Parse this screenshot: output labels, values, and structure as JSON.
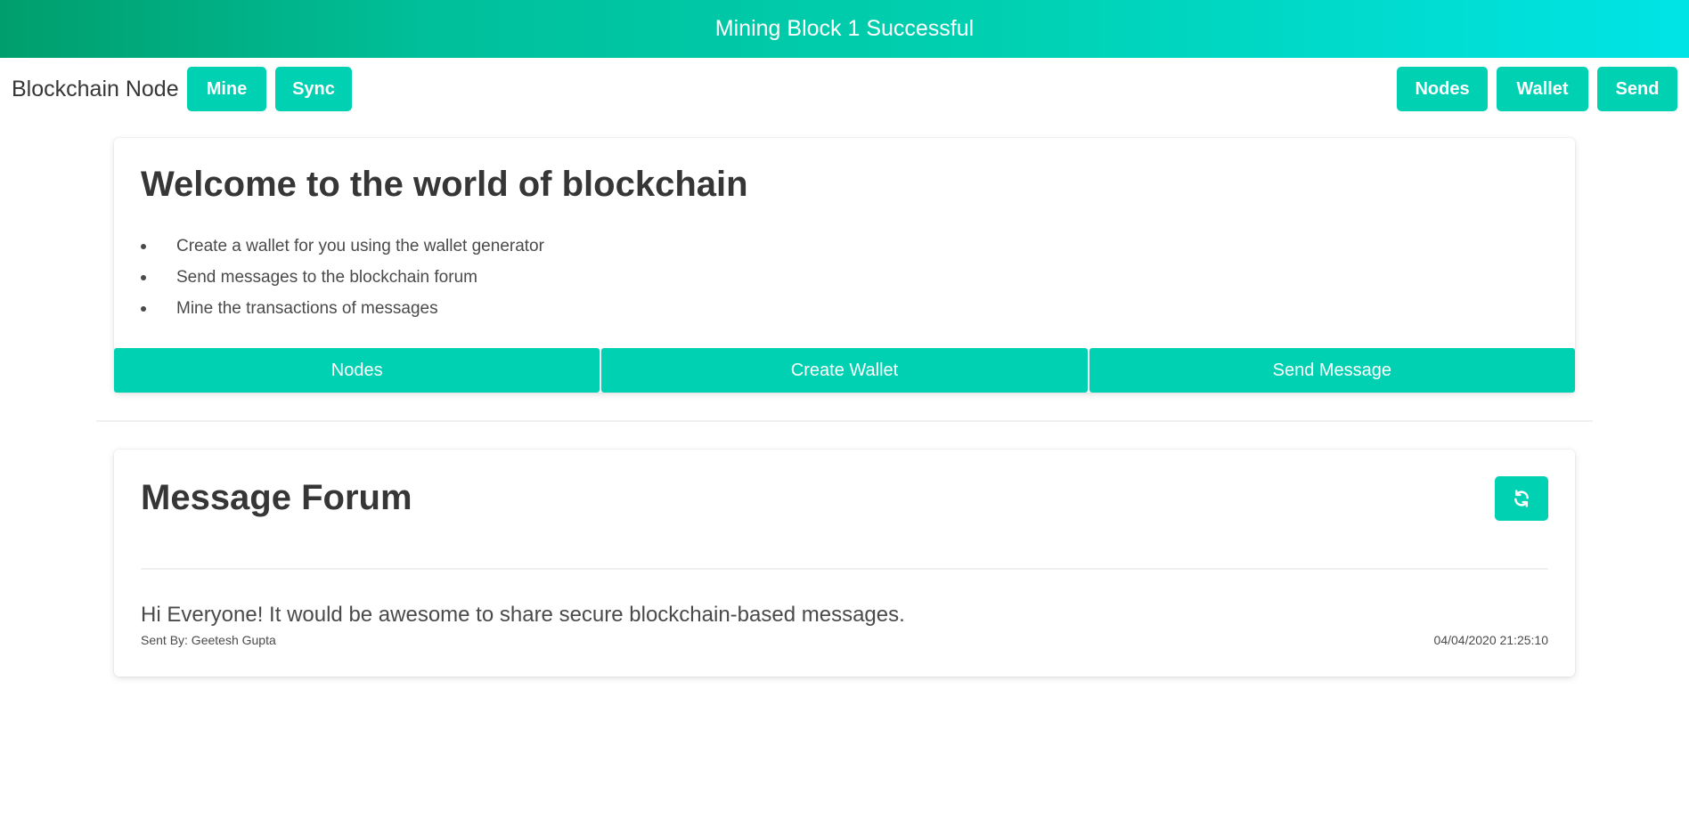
{
  "notification": {
    "text": "Mining Block 1 Successful"
  },
  "navbar": {
    "brand": "Blockchain Node",
    "mine_label": "Mine",
    "sync_label": "Sync",
    "nodes_label": "Nodes",
    "wallet_label": "Wallet",
    "send_label": "Send"
  },
  "welcome": {
    "title": "Welcome to the world of blockchain",
    "items": [
      "Create a wallet for you using the wallet generator",
      "Send messages to the blockchain forum",
      "Mine the transactions of messages"
    ],
    "buttons": [
      "Nodes",
      "Create Wallet",
      "Send Message"
    ]
  },
  "forum": {
    "title": "Message Forum",
    "refresh_icon": "refresh-icon",
    "messages": [
      {
        "text": "Hi Everyone! It would be awesome to share secure blockchain-based messages.",
        "sender": "Sent By: Geetesh Gupta",
        "timestamp": "04/04/2020 21:25:10"
      }
    ]
  },
  "colors": {
    "accent": "#00d1b2",
    "gradient_start": "#009e6c",
    "gradient_end": "#00e4e6",
    "text": "#363636"
  }
}
